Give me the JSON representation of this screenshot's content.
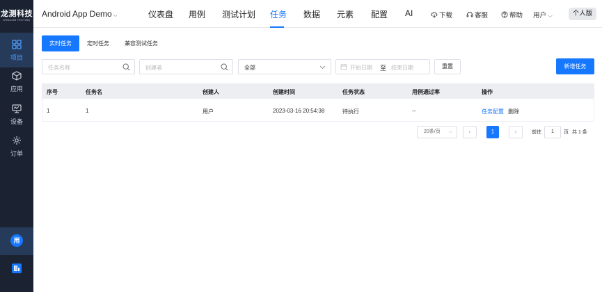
{
  "brand": {
    "name": "龙测科技",
    "subtitle": "DRAGON TESTING"
  },
  "sidebar": {
    "items": [
      {
        "label": "项目",
        "icon": "grid-icon",
        "active": true
      },
      {
        "label": "应用",
        "icon": "cube-icon",
        "active": false
      },
      {
        "label": "设备",
        "icon": "monitor-icon",
        "active": false
      },
      {
        "label": "订单",
        "icon": "gear-icon",
        "active": false
      }
    ],
    "user_initial": "用"
  },
  "header": {
    "project": "Android App Demo",
    "menu": [
      "仪表盘",
      "用例",
      "测试计划",
      "任务",
      "数据",
      "元素",
      "配置",
      "AI"
    ],
    "active_menu": "任务",
    "tools": {
      "download": "下载",
      "service": "客服",
      "help": "帮助",
      "user": "用户"
    },
    "edition": "个人版"
  },
  "tabs": [
    "实时任务",
    "定时任务",
    "兼容测试任务"
  ],
  "filters": {
    "task_name_placeholder": "任务名称",
    "creator_placeholder": "创建者",
    "status_value": "全部",
    "date_start_placeholder": "开始日期",
    "date_sep": "至",
    "date_end_placeholder": "结束日期",
    "reset_label": "重置",
    "new_label": "新增任务"
  },
  "table": {
    "columns": [
      "序号",
      "任务名",
      "创建人",
      "创建时间",
      "任务状态",
      "用例通过率",
      "操作"
    ],
    "rows": [
      {
        "index": "1",
        "name": "1",
        "creator": "用户",
        "created": "2023-03-16 20:54:38",
        "status": "待执行",
        "pass_rate": "--",
        "action_config": "任务配置",
        "action_delete": "删除"
      }
    ]
  },
  "pagination": {
    "page_size": "20条/页",
    "prev": "‹",
    "current": "1",
    "next": "›",
    "goto_label": "前往",
    "goto_value": "1",
    "page_unit": "页",
    "total": "共 1 条"
  },
  "colors": {
    "accent": "#1677ff",
    "sidebar": "#1b2333"
  }
}
